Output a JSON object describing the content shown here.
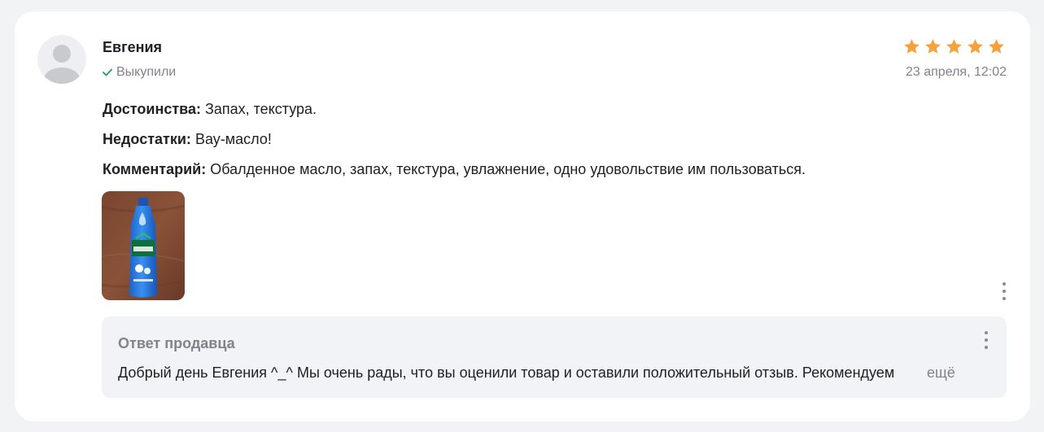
{
  "review": {
    "author": "Евгения",
    "purchased_label": "Выкупили",
    "rating": 5,
    "rating_max": 5,
    "date": "23 апреля, 12:02",
    "pros_label": "Достоинства:",
    "pros": "Запах, текстура.",
    "cons_label": "Недостатки:",
    "cons": "Вау-масло!",
    "comment_label": "Комментарий:",
    "comment": "Обалденное масло, запах, текстура, увлажнение, одно удовольствие им пользоваться.",
    "photo_icon": "coconut-oil-bottle-photo"
  },
  "seller_reply": {
    "title": "Ответ продавца",
    "text": "Добрый день Евгения ^_^ Мы очень рады, что вы оценили товар и оставили положительный отзыв. Рекомендуем",
    "more_label": "ещё"
  },
  "colors": {
    "star": "#f6a23c",
    "verified_check": "#22a05a",
    "muted_text": "#82828c",
    "reply_bg": "#f2f3f6"
  }
}
